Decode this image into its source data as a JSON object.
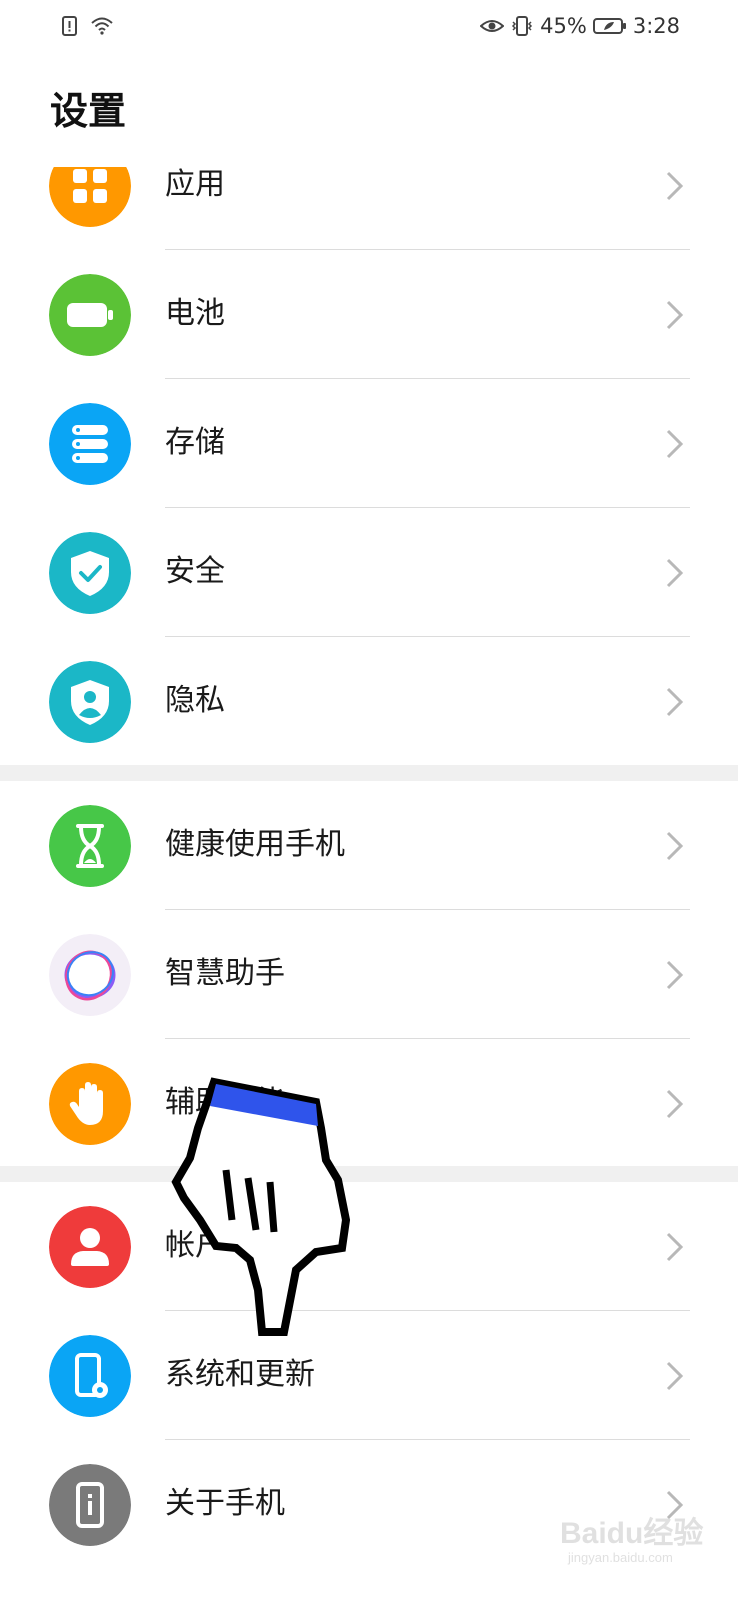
{
  "status_bar": {
    "battery_percent": "45%",
    "time": "3:28",
    "icons": [
      "sim-alert-icon",
      "wifi-icon",
      "eye-comfort-icon",
      "vibrate-icon",
      "battery-icon"
    ]
  },
  "page_title": "设置",
  "items": [
    {
      "label": "应用",
      "icon": "apps-icon",
      "color": "#FF9800"
    },
    {
      "label": "电池",
      "icon": "battery-icon",
      "color": "#5BC236"
    },
    {
      "label": "存储",
      "icon": "storage-icon",
      "color": "#0AA5F5"
    },
    {
      "label": "安全",
      "icon": "shield-check-icon",
      "color": "#1BB7C7"
    },
    {
      "label": "隐私",
      "icon": "privacy-icon",
      "color": "#1BB7C7"
    },
    {
      "label": "健康使用手机",
      "icon": "hourglass-icon",
      "color": "#47C748"
    },
    {
      "label": "智慧助手",
      "icon": "assistant-icon",
      "color": "#f3eef7"
    },
    {
      "label": "辅助功能",
      "icon": "hand-icon",
      "color": "#FF9800"
    },
    {
      "label": "帐户",
      "icon": "user-icon",
      "color": "#EF3B3B"
    },
    {
      "label": "系统和更新",
      "icon": "phone-gear-icon",
      "color": "#0AA5F5"
    },
    {
      "label": "关于手机",
      "icon": "phone-info-icon",
      "color": "#7A7A7A"
    }
  ],
  "watermark": {
    "text": "Baidu经验",
    "sub": "jingyan.baidu.com"
  }
}
